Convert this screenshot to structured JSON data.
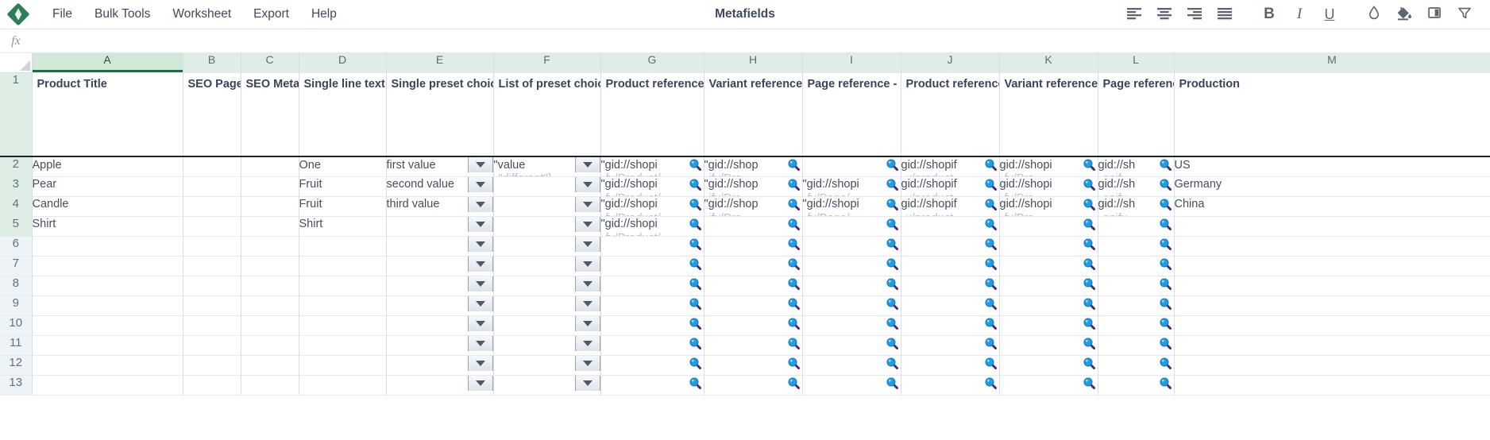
{
  "app": {
    "title": "Metafields",
    "logo_icon": "diamond-logo-icon"
  },
  "menu": {
    "items": [
      {
        "label": "File",
        "name": "menu-file"
      },
      {
        "label": "Bulk Tools",
        "name": "menu-bulk-tools"
      },
      {
        "label": "Worksheet",
        "name": "menu-worksheet"
      },
      {
        "label": "Export",
        "name": "menu-export"
      },
      {
        "label": "Help",
        "name": "menu-help"
      }
    ]
  },
  "toolbar": {
    "buttons": [
      {
        "icon": "align-left-icon",
        "name": "align-left-button"
      },
      {
        "icon": "align-center-icon",
        "name": "align-center-button"
      },
      {
        "icon": "align-right-icon",
        "name": "align-right-button"
      },
      {
        "icon": "align-justify-icon",
        "name": "align-justify-button"
      },
      {
        "icon": "bold-icon",
        "name": "bold-button",
        "glyph": "B"
      },
      {
        "icon": "italic-icon",
        "name": "italic-button",
        "glyph": "I"
      },
      {
        "icon": "underline-icon",
        "name": "underline-button",
        "glyph": "U"
      },
      {
        "icon": "text-color-droplet-icon",
        "name": "text-color-button"
      },
      {
        "icon": "fill-color-bucket-icon",
        "name": "fill-color-button"
      },
      {
        "icon": "freeze-panes-icon",
        "name": "freeze-panes-button"
      },
      {
        "icon": "filter-funnel-icon",
        "name": "filter-button"
      }
    ],
    "accent_color": "#5c6672"
  },
  "formula_bar": {
    "fx_label": "fx",
    "value": "",
    "placeholder": ""
  },
  "grid": {
    "selected_column": "A",
    "column_letters": [
      "A",
      "B",
      "C",
      "D",
      "E",
      "F",
      "G",
      "H",
      "I",
      "J",
      "K",
      "L",
      "M"
    ],
    "row_numbers": [
      "1",
      "2",
      "3",
      "4",
      "5",
      "6",
      "7",
      "8",
      "9",
      "10",
      "11",
      "12"
    ],
    "data_row_count": 5,
    "headers": [
      "Product Title",
      "SEO Page Title",
      "SEO Meta Description",
      "Single line text",
      "Single preset choice",
      "List of preset choices",
      "Product reference - list",
      "Variant reference - list",
      "Page reference - list",
      "Product reference",
      "Variant reference",
      "Page reference",
      "Production"
    ],
    "rows": [
      {
        "number": "2",
        "cells": [
          {
            "text": "Apple"
          },
          {
            "text": ""
          },
          {
            "text": ""
          },
          {
            "text": "One"
          },
          {
            "text": "first value",
            "dropdown": true
          },
          {
            "text": "\"value",
            "ghost": "\"different\"]",
            "dropdown": true
          },
          {
            "text": "\"gid://shopi",
            "ghost": "fy/Product/",
            "magnifier": true
          },
          {
            "text": "\"gid://shop",
            "ghost": "ify/Pro",
            "magnifier": true
          },
          {
            "text": "",
            "magnifier": true
          },
          {
            "text": "gid://shopif",
            "ghost": "y/product",
            "magnifier": true
          },
          {
            "text": "gid://shopi",
            "ghost": "fy/Pro",
            "magnifier": true
          },
          {
            "text": "gid://sh",
            "ghost": "opify",
            "magnifier": true
          },
          {
            "text": "US"
          }
        ]
      },
      {
        "number": "3",
        "cells": [
          {
            "text": "Pear"
          },
          {
            "text": ""
          },
          {
            "text": ""
          },
          {
            "text": "Fruit"
          },
          {
            "text": "second value",
            "dropdown": true
          },
          {
            "text": "",
            "dropdown": true
          },
          {
            "text": "\"gid://shopi",
            "ghost": "fy/Product/",
            "magnifier": true
          },
          {
            "text": "\"gid://shop",
            "ghost": "ify/Pro",
            "magnifier": true
          },
          {
            "text": "\"gid://shopi",
            "ghost": "fy/Page/",
            "magnifier": true
          },
          {
            "text": "gid://shopif",
            "ghost": "y/product",
            "magnifier": true
          },
          {
            "text": "gid://shopi",
            "ghost": "fy/Pro",
            "magnifier": true
          },
          {
            "text": "gid://sh",
            "ghost": "opify",
            "magnifier": true
          },
          {
            "text": "Germany"
          }
        ]
      },
      {
        "number": "4",
        "cells": [
          {
            "text": "Candle"
          },
          {
            "text": ""
          },
          {
            "text": ""
          },
          {
            "text": "Fruit"
          },
          {
            "text": "third value",
            "dropdown": true
          },
          {
            "text": "",
            "dropdown": true
          },
          {
            "text": "\"gid://shopi",
            "ghost": "fy/Product/",
            "magnifier": true
          },
          {
            "text": "\"gid://shop",
            "ghost": "ify/Pro",
            "magnifier": true
          },
          {
            "text": "\"gid://shopi",
            "ghost": "fy/Page/",
            "magnifier": true
          },
          {
            "text": "gid://shopif",
            "ghost": "y/product",
            "magnifier": true
          },
          {
            "text": "gid://shopi",
            "ghost": "fy/Pro",
            "magnifier": true
          },
          {
            "text": "gid://sh",
            "ghost": "opify",
            "magnifier": true
          },
          {
            "text": "China"
          }
        ]
      },
      {
        "number": "5",
        "cells": [
          {
            "text": "Shirt"
          },
          {
            "text": ""
          },
          {
            "text": ""
          },
          {
            "text": "Shirt"
          },
          {
            "text": "",
            "dropdown": true
          },
          {
            "text": "",
            "dropdown": true
          },
          {
            "text": "\"gid://shopi",
            "ghost": "fy/Product/",
            "magnifier": true
          },
          {
            "text": "",
            "magnifier": true
          },
          {
            "text": "",
            "magnifier": true
          },
          {
            "text": "",
            "magnifier": true
          },
          {
            "text": "",
            "magnifier": true
          },
          {
            "text": "",
            "magnifier": true
          },
          {
            "text": ""
          }
        ]
      },
      {
        "number": "6",
        "cells": [
          {
            "text": ""
          },
          {
            "text": ""
          },
          {
            "text": ""
          },
          {
            "text": ""
          },
          {
            "text": "",
            "dropdown": true
          },
          {
            "text": "",
            "dropdown": true
          },
          {
            "text": "",
            "magnifier": true
          },
          {
            "text": "",
            "magnifier": true
          },
          {
            "text": "",
            "magnifier": true
          },
          {
            "text": "",
            "magnifier": true
          },
          {
            "text": "",
            "magnifier": true
          },
          {
            "text": "",
            "magnifier": true
          },
          {
            "text": ""
          }
        ]
      },
      {
        "number": "7",
        "cells": [
          {
            "text": ""
          },
          {
            "text": ""
          },
          {
            "text": ""
          },
          {
            "text": ""
          },
          {
            "text": "",
            "dropdown": true
          },
          {
            "text": "",
            "dropdown": true
          },
          {
            "text": "",
            "magnifier": true
          },
          {
            "text": "",
            "magnifier": true
          },
          {
            "text": "",
            "magnifier": true
          },
          {
            "text": "",
            "magnifier": true
          },
          {
            "text": "",
            "magnifier": true
          },
          {
            "text": "",
            "magnifier": true
          },
          {
            "text": ""
          }
        ]
      },
      {
        "number": "8",
        "cells": [
          {
            "text": ""
          },
          {
            "text": ""
          },
          {
            "text": ""
          },
          {
            "text": ""
          },
          {
            "text": "",
            "dropdown": true
          },
          {
            "text": "",
            "dropdown": true
          },
          {
            "text": "",
            "magnifier": true
          },
          {
            "text": "",
            "magnifier": true
          },
          {
            "text": "",
            "magnifier": true
          },
          {
            "text": "",
            "magnifier": true
          },
          {
            "text": "",
            "magnifier": true
          },
          {
            "text": "",
            "magnifier": true
          },
          {
            "text": ""
          }
        ]
      },
      {
        "number": "9",
        "cells": [
          {
            "text": ""
          },
          {
            "text": ""
          },
          {
            "text": ""
          },
          {
            "text": ""
          },
          {
            "text": "",
            "dropdown": true
          },
          {
            "text": "",
            "dropdown": true
          },
          {
            "text": "",
            "magnifier": true
          },
          {
            "text": "",
            "magnifier": true
          },
          {
            "text": "",
            "magnifier": true
          },
          {
            "text": "",
            "magnifier": true
          },
          {
            "text": "",
            "magnifier": true
          },
          {
            "text": "",
            "magnifier": true
          },
          {
            "text": ""
          }
        ]
      },
      {
        "number": "10",
        "cells": [
          {
            "text": ""
          },
          {
            "text": ""
          },
          {
            "text": ""
          },
          {
            "text": ""
          },
          {
            "text": "",
            "dropdown": true
          },
          {
            "text": "",
            "dropdown": true
          },
          {
            "text": "",
            "magnifier": true
          },
          {
            "text": "",
            "magnifier": true
          },
          {
            "text": "",
            "magnifier": true
          },
          {
            "text": "",
            "magnifier": true
          },
          {
            "text": "",
            "magnifier": true
          },
          {
            "text": "",
            "magnifier": true
          },
          {
            "text": ""
          }
        ]
      },
      {
        "number": "11",
        "cells": [
          {
            "text": ""
          },
          {
            "text": ""
          },
          {
            "text": ""
          },
          {
            "text": ""
          },
          {
            "text": "",
            "dropdown": true
          },
          {
            "text": "",
            "dropdown": true
          },
          {
            "text": "",
            "magnifier": true
          },
          {
            "text": "",
            "magnifier": true
          },
          {
            "text": "",
            "magnifier": true
          },
          {
            "text": "",
            "magnifier": true
          },
          {
            "text": "",
            "magnifier": true
          },
          {
            "text": "",
            "magnifier": true
          },
          {
            "text": ""
          }
        ]
      },
      {
        "number": "12",
        "cells": [
          {
            "text": ""
          },
          {
            "text": ""
          },
          {
            "text": ""
          },
          {
            "text": ""
          },
          {
            "text": "",
            "dropdown": true
          },
          {
            "text": "",
            "dropdown": true
          },
          {
            "text": "",
            "magnifier": true
          },
          {
            "text": "",
            "magnifier": true
          },
          {
            "text": "",
            "magnifier": true
          },
          {
            "text": "",
            "magnifier": true
          },
          {
            "text": "",
            "magnifier": true
          },
          {
            "text": "",
            "magnifier": true
          },
          {
            "text": ""
          }
        ]
      },
      {
        "number": "13",
        "cells": [
          {
            "text": ""
          },
          {
            "text": ""
          },
          {
            "text": ""
          },
          {
            "text": ""
          },
          {
            "text": "",
            "dropdown": true
          },
          {
            "text": "",
            "dropdown": true
          },
          {
            "text": "",
            "magnifier": true
          },
          {
            "text": "",
            "magnifier": true
          },
          {
            "text": "",
            "magnifier": true
          },
          {
            "text": "",
            "magnifier": true
          },
          {
            "text": "",
            "magnifier": true
          },
          {
            "text": "",
            "magnifier": true
          },
          {
            "text": ""
          }
        ]
      }
    ]
  },
  "colors": {
    "header_green": "#dfeee4",
    "selected_header_green": "#cfe8d8",
    "selection_underline": "#1f6b42",
    "magnifier_lens": "#1f9ce8",
    "magnifier_handle": "#4e2a7a",
    "text": "#3d4b5c",
    "grid_line": "#d7dde3"
  }
}
